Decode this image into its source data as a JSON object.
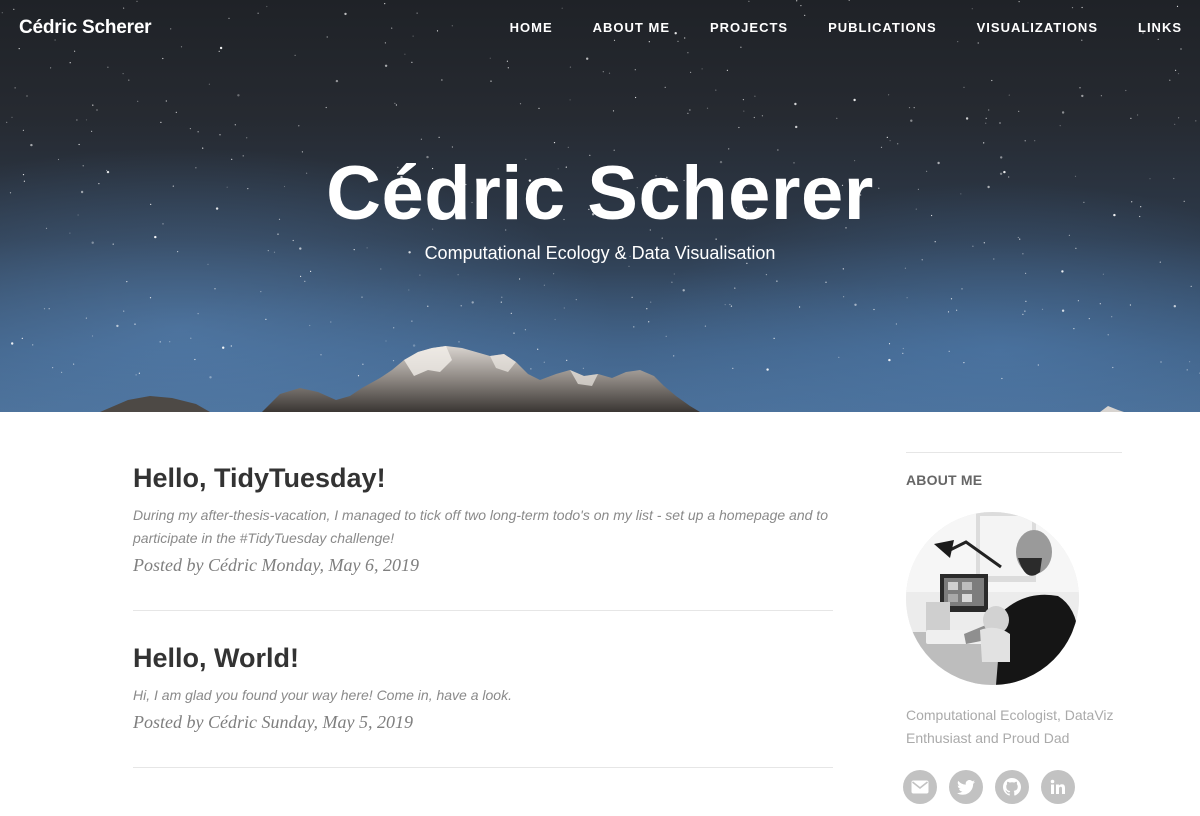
{
  "header": {
    "brand": "Cédric Scherer",
    "nav": [
      {
        "label": "HOME"
      },
      {
        "label": "ABOUT ME"
      },
      {
        "label": "PROJECTS"
      },
      {
        "label": "PUBLICATIONS"
      },
      {
        "label": "VISUALIZATIONS"
      },
      {
        "label": "LINKS"
      }
    ]
  },
  "hero": {
    "title": "Cédric Scherer",
    "subtitle": "Computational Ecology & Data Visualisation"
  },
  "posts": [
    {
      "title": "Hello, TidyTuesday!",
      "excerpt": "During my after-thesis-vacation, I managed to tick off two long-term todo's on my list - set up a homepage and to participate in the #TidyTuesday challenge!",
      "meta": "Posted by Cédric Monday, May 6, 2019"
    },
    {
      "title": "Hello, World!",
      "excerpt": "Hi, I am glad you found your way here! Come in, have a look.",
      "meta": "Posted by Cédric Sunday, May 5, 2019"
    }
  ],
  "sidebar": {
    "heading": "ABOUT ME",
    "bio": "Computational Ecologist, DataViz Enthusiast and Proud Dad",
    "social": [
      {
        "icon": "envelope-icon"
      },
      {
        "icon": "twitter-icon"
      },
      {
        "icon": "github-icon"
      },
      {
        "icon": "linkedin-icon"
      }
    ]
  },
  "colors": {
    "hero_sky_top": "#1f2227",
    "hero_sky_bottom": "#4a6d93",
    "post_title": "#333333",
    "post_excerpt": "#8a8a8a",
    "social_button": "#c2c2c2"
  }
}
